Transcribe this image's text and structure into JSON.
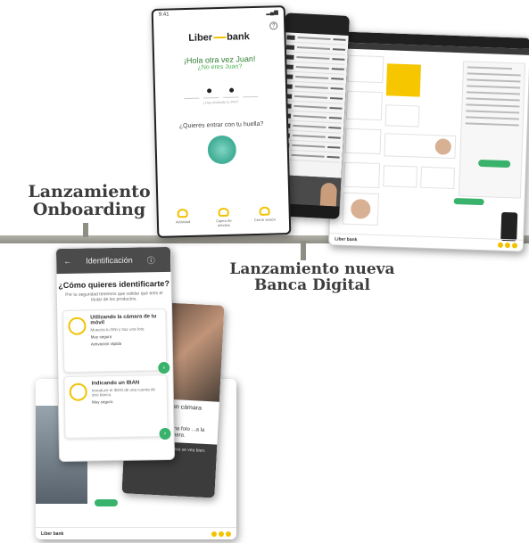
{
  "captions": {
    "onboarding": "Lanzamiento Onboarding",
    "banca": "Lanzamiento nueva Banca Digital"
  },
  "phone_login": {
    "time": "9:41",
    "logo_left": "Liber",
    "logo_right": "bank",
    "greeting": "¡Hola otra vez Juan!",
    "not_you": "¿No eres Juan?",
    "forgot": "¿Has olvidado tu PIN?",
    "fingerprint_question": "¿Quieres entrar con tu huella?",
    "bottom_items": [
      "Actividad",
      "Cajero de efectivo",
      "Cerrar sesión"
    ]
  },
  "phone_identify": {
    "title": "Identificación",
    "question": "¿Cómo quieres identificarte?",
    "intro": "Por tu seguridad tenemos que validar que eres el titular de los productos.",
    "options": [
      {
        "title": "Utilizando la cámara de tu móvil",
        "desc": "Muestra tu DNI y haz una foto.",
        "f1": "Muy seguro",
        "f2": "Activación rápida"
      },
      {
        "title": "Indicando un IBAN",
        "desc": "Introduce el IBAN de una cuenta de otro banco.",
        "f1": "Muy seguro"
      }
    ]
  },
  "phone_camera": {
    "title": "Validación",
    "heading": "...con cámara",
    "sub": "...una foto ...a la cámara.",
    "footer": "Asegúrate de que tu cara se vea bien."
  },
  "desktop": {
    "logo": "Liber bank"
  }
}
